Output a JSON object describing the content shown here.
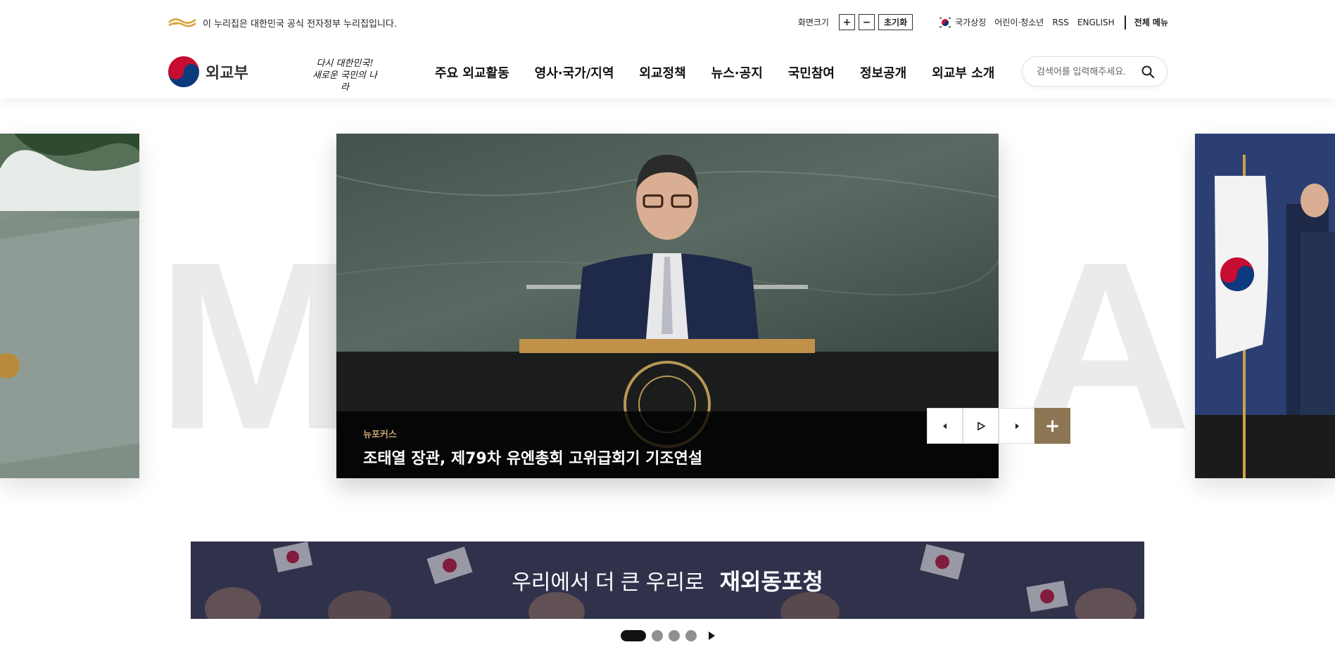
{
  "gov_banner": {
    "text": "이 누리집은 대한민국 공식 전자정부 누리집입니다."
  },
  "utility": {
    "font_size_label": "화면크기",
    "plus": "+",
    "minus": "−",
    "reset": "초기화",
    "links": [
      "국가상징",
      "어린이·청소년",
      "RSS",
      "ENGLISH"
    ],
    "all_menu": "전체 메뉴"
  },
  "logo": {
    "text": "외교부"
  },
  "slogan": {
    "line1": "다시 대한민국!",
    "line2": "새로운 국민의 나라"
  },
  "gnb": [
    "주요 외교활동",
    "영사·국가/지역",
    "외교정책",
    "뉴스·공지",
    "국민참여",
    "정보공개",
    "외교부 소개"
  ],
  "search": {
    "placeholder": "검색어를 입력해주세요."
  },
  "hero": {
    "bg_letters": [
      "M",
      "A"
    ],
    "caption_tag": "뉴포커스",
    "caption_title": "조태열 장관, 제79차 유엔총회 고위급회기 기조연설",
    "plus_label": "+"
  },
  "banner": {
    "sub": "우리에서 더 큰 우리로",
    "main": "재외동포청"
  },
  "colors": {
    "accent_gold": "#8c7552",
    "tag_gold": "#c7a56f",
    "banner_bg": "#35375a"
  },
  "pagination": {
    "total": 4,
    "active": 1
  }
}
